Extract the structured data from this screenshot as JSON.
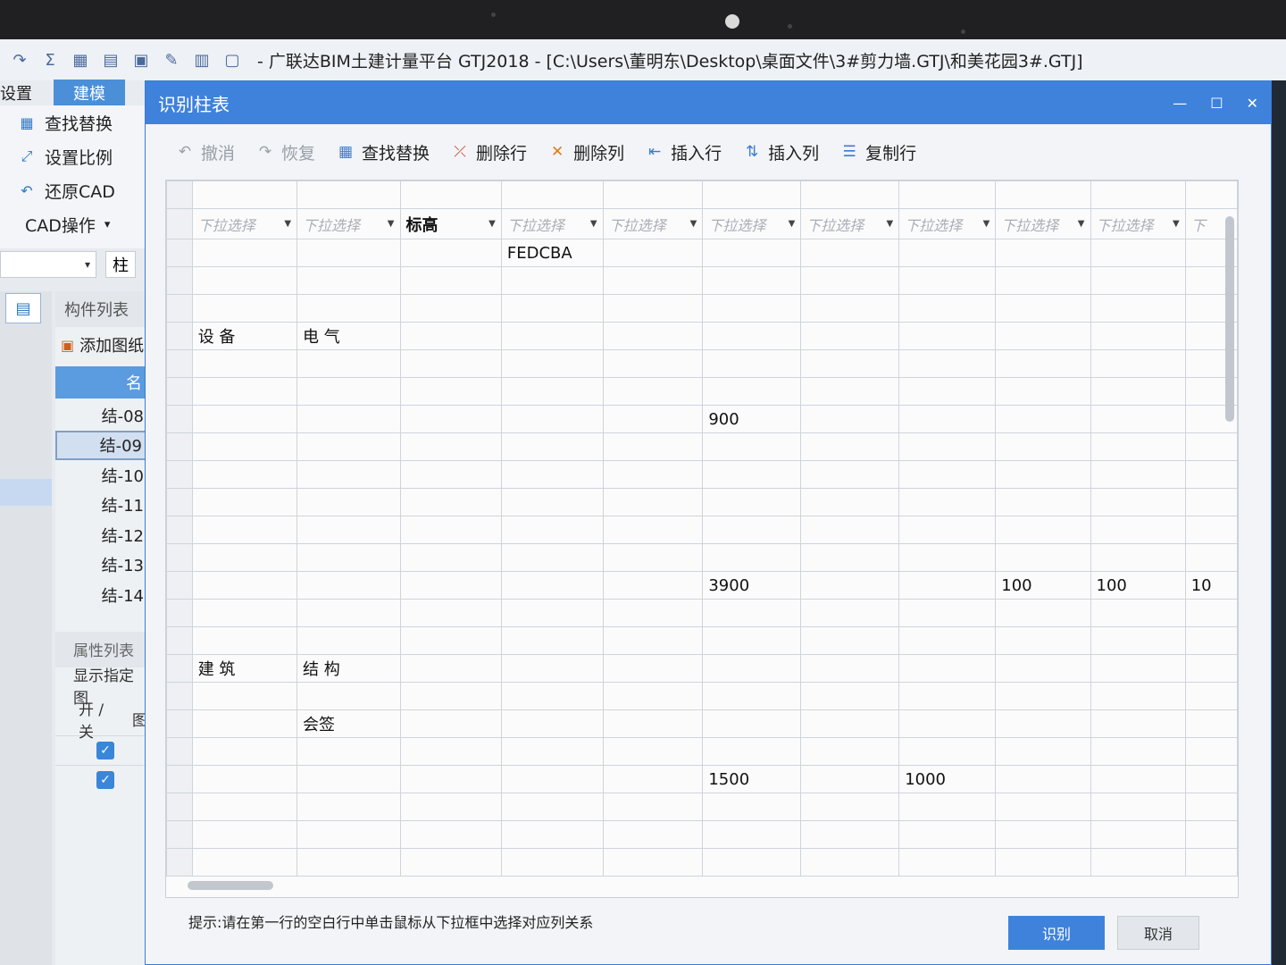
{
  "app": {
    "title": "- 广联达BIM土建计量平台 GTJ2018 - [C:\\Users\\董明东\\Desktop\\桌面文件\\3#剪力墙.GTJ\\和美花园3#.GTJ]",
    "quick_access_icons": [
      "undo-icon",
      "redo-icon",
      "sum-icon",
      "table-icon",
      "report-icon",
      "export-icon",
      "edit-icon",
      "grid-icon",
      "open-icon"
    ]
  },
  "ribbon": {
    "tabs": [
      "设置",
      "建模"
    ],
    "active_tab": "建模",
    "items": [
      {
        "label": "查找替换",
        "icon": "find-replace-icon"
      },
      {
        "label": "设置比例",
        "icon": "set-scale-icon"
      },
      {
        "label": "还原CAD",
        "icon": "restore-cad-icon"
      }
    ],
    "cad_menu": "CAD操作"
  },
  "left": {
    "combo_value": "",
    "type_button": "柱",
    "component_list_title": "构件列表",
    "add_layer_label": "添加图纸",
    "list_header": "名",
    "components": [
      "结-08",
      "结-09",
      "结-10",
      "结-11",
      "结-12",
      "结-13",
      "结-14"
    ],
    "selected_component": "结-09",
    "property_list_title": "属性列表",
    "show_drawing_label": "显示指定图",
    "property_columns": [
      "开 / 关",
      "图"
    ]
  },
  "dialog": {
    "title": "识别柱表",
    "window_controls": [
      "minimize-icon",
      "maximize-icon",
      "close-icon"
    ],
    "toolbar": [
      {
        "label": "撤消",
        "icon": "undo-icon",
        "enabled": false
      },
      {
        "label": "恢复",
        "icon": "redo-icon",
        "enabled": false
      },
      {
        "label": "查找替换",
        "icon": "find-replace-icon",
        "enabled": true
      },
      {
        "label": "删除行",
        "icon": "delete-row-icon",
        "enabled": true
      },
      {
        "label": "删除列",
        "icon": "delete-column-icon",
        "enabled": true
      },
      {
        "label": "插入行",
        "icon": "insert-row-icon",
        "enabled": true
      },
      {
        "label": "插入列",
        "icon": "insert-column-icon",
        "enabled": true
      },
      {
        "label": "复制行",
        "icon": "copy-row-icon",
        "enabled": true
      }
    ],
    "grid": {
      "column_headers": [
        "下拉选择",
        "下拉选择",
        "标高",
        "下拉选择",
        "下拉选择",
        "下拉选择",
        "下拉选择",
        "下拉选择",
        "下拉选择",
        "下拉选择",
        "下"
      ],
      "rows": [
        [
          "",
          "",
          "",
          "FEDCBA",
          "",
          "",
          "",
          "",
          "",
          "",
          ""
        ],
        [
          "",
          "",
          "",
          "",
          "",
          "",
          "",
          "",
          "",
          "",
          ""
        ],
        [
          "",
          "",
          "",
          "",
          "",
          "",
          "",
          "",
          "",
          "",
          ""
        ],
        [
          "设 备",
          "电 气",
          "",
          "",
          "",
          "",
          "",
          "",
          "",
          "",
          ""
        ],
        [
          "",
          "",
          "",
          "",
          "",
          "",
          "",
          "",
          "",
          "",
          ""
        ],
        [
          "",
          "",
          "",
          "",
          "",
          "",
          "",
          "",
          "",
          "",
          ""
        ],
        [
          "",
          "",
          "",
          "",
          "",
          "900",
          "",
          "",
          "",
          "",
          ""
        ],
        [
          "",
          "",
          "",
          "",
          "",
          "",
          "",
          "",
          "",
          "",
          ""
        ],
        [
          "",
          "",
          "",
          "",
          "",
          "",
          "",
          "",
          "",
          "",
          ""
        ],
        [
          "",
          "",
          "",
          "",
          "",
          "",
          "",
          "",
          "",
          "",
          ""
        ],
        [
          "",
          "",
          "",
          "",
          "",
          "",
          "",
          "",
          "",
          "",
          ""
        ],
        [
          "",
          "",
          "",
          "",
          "",
          "",
          "",
          "",
          "",
          "",
          ""
        ],
        [
          "",
          "",
          "",
          "",
          "",
          "3900",
          "",
          "",
          "100",
          "100",
          "10"
        ],
        [
          "",
          "",
          "",
          "",
          "",
          "",
          "",
          "",
          "",
          "",
          ""
        ],
        [
          "",
          "",
          "",
          "",
          "",
          "",
          "",
          "",
          "",
          "",
          ""
        ],
        [
          "建 筑",
          "结 构",
          "",
          "",
          "",
          "",
          "",
          "",
          "",
          "",
          ""
        ],
        [
          "",
          "",
          "",
          "",
          "",
          "",
          "",
          "",
          "",
          "",
          ""
        ],
        [
          "",
          "会签",
          "",
          "",
          "",
          "",
          "",
          "",
          "",
          "",
          ""
        ],
        [
          "",
          "",
          "",
          "",
          "",
          "",
          "",
          "",
          "",
          "",
          ""
        ],
        [
          "",
          "",
          "",
          "",
          "",
          "1500",
          "",
          "1000",
          "",
          "",
          ""
        ],
        [
          "",
          "",
          "",
          "",
          "",
          "",
          "",
          "",
          "",
          "",
          ""
        ],
        [
          "",
          "",
          "",
          "",
          "",
          "",
          "",
          "",
          "",
          "",
          ""
        ],
        [
          "",
          "",
          "",
          "",
          "",
          "",
          "",
          "",
          "",
          "",
          ""
        ]
      ]
    },
    "hint": "提示:请在第一行的空白行中单击鼠标从下拉框中选择对应列关系",
    "ok_button": "识别",
    "cancel_button": "取消"
  }
}
